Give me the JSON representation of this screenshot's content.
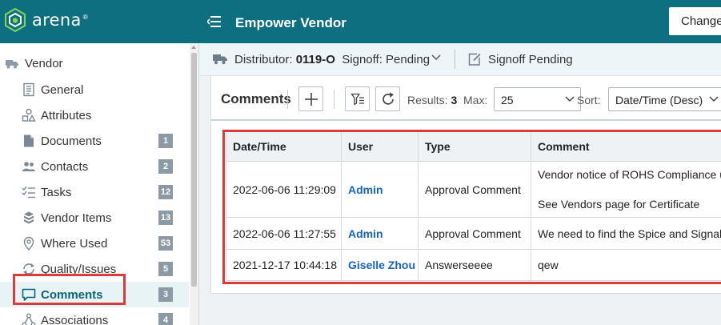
{
  "app": {
    "logo_text": "arena",
    "logo_reg": "®",
    "title": "Empower Vendor",
    "changes_button": "Changes"
  },
  "sidebar": {
    "root_label": "Vendor",
    "items": [
      {
        "label": "General",
        "badge": "",
        "icon": "document-list-icon"
      },
      {
        "label": "Attributes",
        "badge": "",
        "icon": "shapes-icon"
      },
      {
        "label": "Documents",
        "badge": "1",
        "icon": "file-icon"
      },
      {
        "label": "Contacts",
        "badge": "2",
        "icon": "people-icon"
      },
      {
        "label": "Tasks",
        "badge": "12",
        "icon": "checklist-icon"
      },
      {
        "label": "Vendor Items",
        "badge": "13",
        "icon": "cubes-icon"
      },
      {
        "label": "Where Used",
        "badge": "53",
        "icon": "map-pin-icon"
      },
      {
        "label": "Quality/Issues",
        "badge": "5",
        "icon": "refresh-cycle-icon"
      },
      {
        "label": "Comments",
        "badge": "3",
        "icon": "comment-icon"
      },
      {
        "label": "Associations",
        "badge": "4",
        "icon": "hierarchy-icon"
      }
    ]
  },
  "subheader": {
    "distributor_label": "Distributor:",
    "distributor_id": "0119-O",
    "signoff_label": "Signoff: Pending",
    "signoff_pending": "Signoff Pending"
  },
  "toolbar": {
    "title": "Comments",
    "results_label": "Results:",
    "results_count": "3",
    "max_label": "Max:",
    "max_value": "25",
    "sort_label": "Sort:",
    "sort_value": "Date/Time (Desc)"
  },
  "table": {
    "columns": [
      "Date/Time",
      "User",
      "Type",
      "Comment"
    ],
    "rows": [
      {
        "datetime": "2022-06-06 11:29:09",
        "user": "Admin",
        "type": "Approval Comment",
        "comment_line1": "Vendor notice of ROHS Compliance u",
        "comment_line2": "See Vendors page for Certificate"
      },
      {
        "datetime": "2022-06-06 11:27:55",
        "user": "Admin",
        "type": "Approval Comment",
        "comment": "We need to find the Spice and Signal"
      },
      {
        "datetime": "2021-12-17 10:44:18",
        "user": "Giselle Zhou",
        "type": "Answerseeee",
        "comment": "qew"
      }
    ]
  },
  "colors": {
    "topbar": "#0e6f80",
    "highlight": "#dc3b3b",
    "link": "#1565c0",
    "badge": "#8c9aa6"
  }
}
